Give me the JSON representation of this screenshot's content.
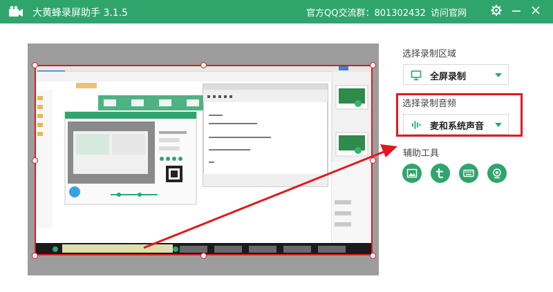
{
  "app": {
    "title": "大黄蜂录屏助手 3.1.5"
  },
  "header": {
    "qq_group": "官方QQ交流群：801302432",
    "visit_site": "访问官网"
  },
  "icons": {
    "settings": "gear-icon",
    "minimize": "minimize-icon",
    "close": "close-icon",
    "logo": "camera-logo-icon"
  },
  "record_area": {
    "label": "选择录制区域",
    "selected": "全屏录制",
    "icon": "monitor-icon"
  },
  "record_audio": {
    "label": "选择录制音频",
    "selected": "麦和系统声音",
    "icon": "audio-wave-icon"
  },
  "tools": {
    "label": "辅助工具",
    "items": [
      {
        "name": "image-tool",
        "icon": "image-icon"
      },
      {
        "name": "text-tool",
        "icon": "t-icon"
      },
      {
        "name": "keyboard-tool",
        "icon": "keyboard-icon"
      },
      {
        "name": "webcam-tool",
        "icon": "webcam-icon"
      }
    ]
  },
  "colors": {
    "brand": "#2fa56c",
    "highlight": "#e0191f",
    "preview_bg": "#9d9d9d"
  }
}
